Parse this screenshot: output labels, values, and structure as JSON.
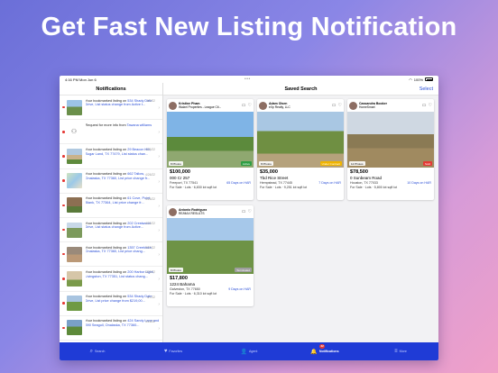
{
  "headline": "Get Fast New Listing Notification",
  "status_bar": {
    "time": "4:16 PM",
    "date": "Mon Jun 6",
    "battery": "100%"
  },
  "left": {
    "title": "Notifications",
    "items": [
      {
        "pre": "Your bookmarked listing on ",
        "link": "534 Shady Date Drive, List status change from Active t...",
        "date": "6/2/22",
        "thumb": "thumb-house-1"
      },
      {
        "pre": "Request for more info from ",
        "link": "Tawana williams",
        "date": "",
        "thumb": "person-icon"
      },
      {
        "pre": "Your bookmarked listing on ",
        "link": "29 Beacon Hill, Sugar Land, TX 77479, List status chan...",
        "date": "4/26/22",
        "thumb": "thumb-house-2"
      },
      {
        "pre": "Your bookmarked listing on ",
        "link": "662 Tallow, Onalaska, TX 77360, List price change fr...",
        "date": "4/26/22",
        "thumb": "thumb-map"
      },
      {
        "pre": "Your bookmarked listing on ",
        "link": "61 Cove, Point Blank, TX 77364, List price change fr...",
        "date": "4/26/22",
        "thumb": "thumb-house-3"
      },
      {
        "pre": "Your bookmarked listing on ",
        "link": "202 Crestwood Drive, List status change from Active...",
        "date": "4/26/22",
        "thumb": "thumb-house-4"
      },
      {
        "pre": "Your bookmarked listing on ",
        "link": "1357 Creeklake, Onalaska, TX 77360, List price chang...",
        "date": "4/22/22",
        "thumb": "thumb-house-5"
      },
      {
        "pre": "Your bookmarked listing on ",
        "link": "200 Harbor Light, Livingston, TX 77351, List status chang...",
        "date": "4/20/22",
        "thumb": "thumb-house-6"
      },
      {
        "pre": "Your bookmarked listing on ",
        "link": "534 Shady Date Drive, List price change from $219,00...",
        "date": "4/7/22",
        "thumb": "thumb-house-7"
      },
      {
        "pre": "Your bookmarked listing on ",
        "link": "424 Sandy Lane and 390 Seagull, Onalaska, TX 77360...",
        "date": "3/16/22",
        "thumb": "thumb-house-8"
      }
    ]
  },
  "right": {
    "title": "Saved Search",
    "select_label": "Select",
    "cards": [
      {
        "agent_name": "Kristine Pham",
        "agent_company": "Walzel Properties - League Cit...",
        "photos": "8 Photos",
        "status": "Active",
        "status_color": "#2e9e44",
        "price": "$100,000",
        "address": "000 Cr 257",
        "city": "Freeport, TX 77541",
        "days": "65 Days on HAR",
        "meta": "For Sale · Lots · 6,830 lot sqft lot"
      },
      {
        "agent_name": "Adam Olsen",
        "agent_company": "eXp Realty, LLC",
        "photos": "8 Photos",
        "status": "Under Contract",
        "status_color": "#f0b400",
        "price": "$35,000",
        "address": "Tbd Rice Street",
        "city": "Hempstead, TX 77445",
        "days": "7 Days on HAR",
        "meta": "For Sale · Lots · 9,251 lot sqft lot"
      },
      {
        "agent_name": "Cassandra Booker",
        "agent_company": "HomeSmart",
        "photos": "12 Photos",
        "status": "Sold",
        "status_color": "#e53935",
        "price": "$78,500",
        "address": "0 Sunbeam Road",
        "city": "Houston, TX 77033",
        "days": "10 Days on HAR",
        "meta": "For Sale · Lots · 5,800 lot sqft lot"
      },
      {
        "agent_name": "Antonio Rodriguez",
        "agent_company": "RE/MAX RESULTS",
        "photos": "8 Photos",
        "status": "Terminated",
        "status_color": "#9e9e9e",
        "price": "$17,800",
        "address": "1224 Bahama",
        "city": "Galveston, TX 77650",
        "days": "9 Days on HAR",
        "meta": "For Sale · Lots · 6,310 lot sqft lot"
      }
    ]
  },
  "tabbar": {
    "tabs": [
      {
        "label": "Search",
        "icon": "search-icon",
        "glyph": "⌕"
      },
      {
        "label": "Favorites",
        "icon": "heart-icon",
        "glyph": "♥"
      },
      {
        "label": "Agent",
        "icon": "agent-icon",
        "glyph": "👤"
      },
      {
        "label": "Notifications",
        "icon": "bell-icon",
        "glyph": "🔔",
        "badge": "22"
      },
      {
        "label": "More",
        "icon": "menu-icon",
        "glyph": "≡"
      }
    ],
    "active": 3
  }
}
